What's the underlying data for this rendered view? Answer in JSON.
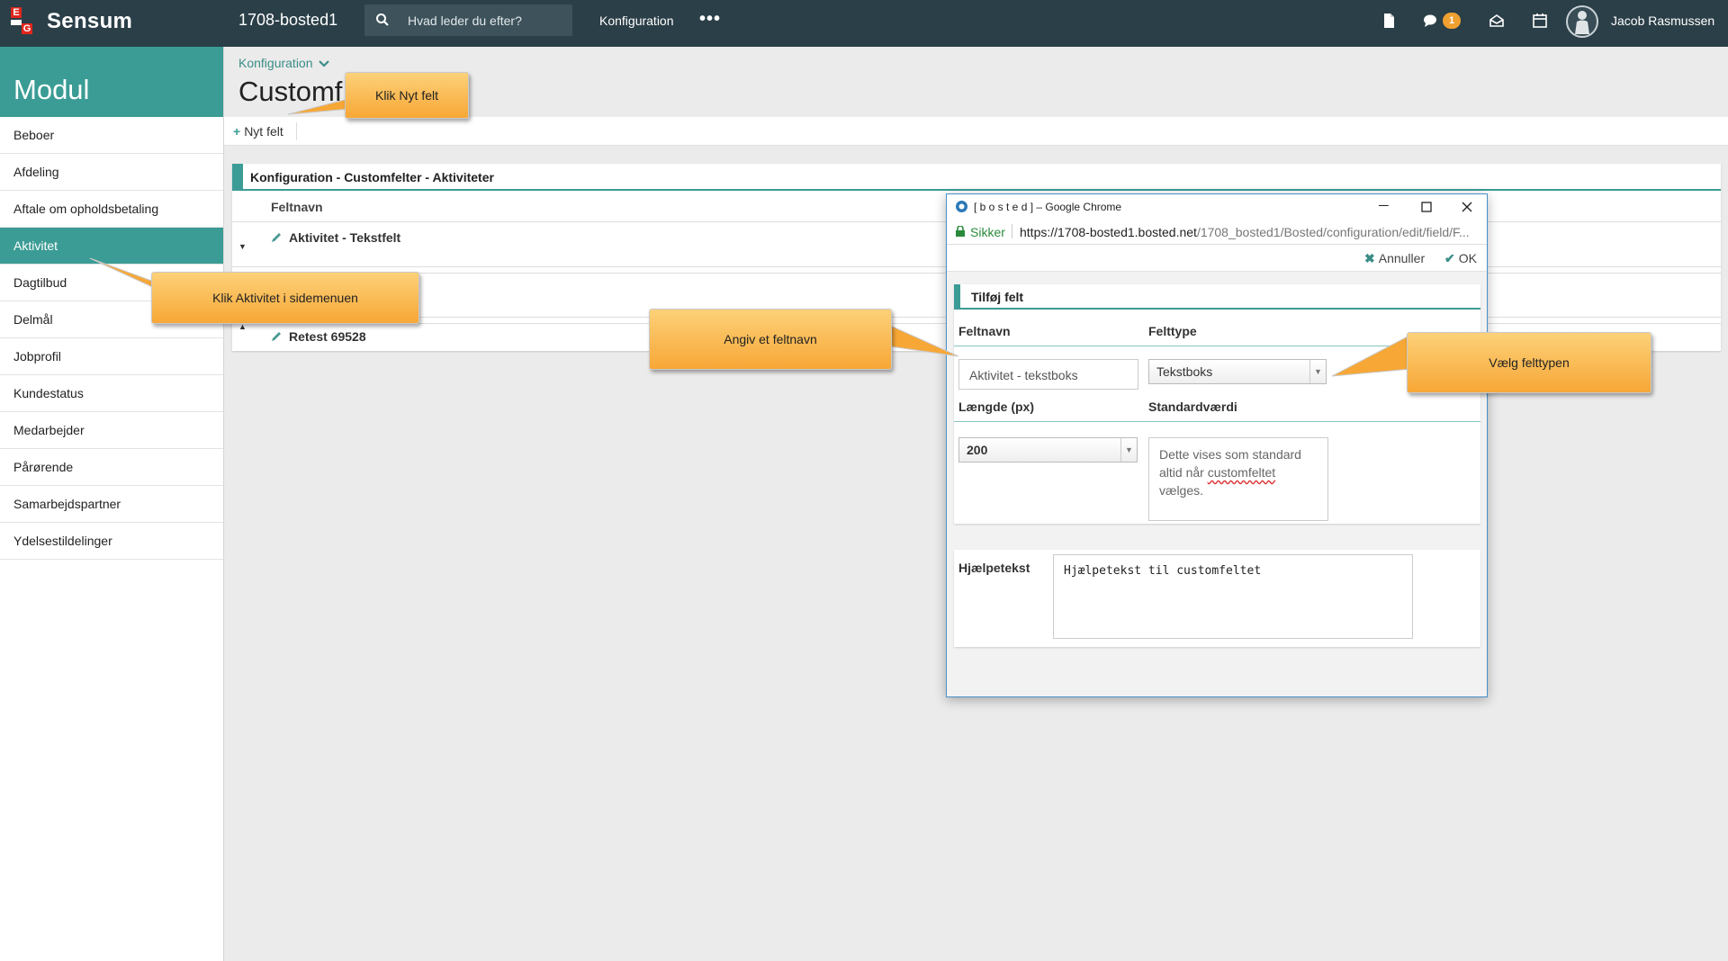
{
  "topbar": {
    "logo_letters": [
      "E",
      "G"
    ],
    "brand": "Sensum",
    "instance": "1708-bosted1",
    "search_placeholder": "Hvad leder du efter?",
    "nav_item": "Konfiguration",
    "more": "•••",
    "notification_count": "1",
    "user_name": "Jacob Rasmussen"
  },
  "sidebar": {
    "title": "Modul",
    "items": [
      {
        "label": "Beboer",
        "active": false
      },
      {
        "label": "Afdeling",
        "active": false
      },
      {
        "label": "Aftale om opholdsbetaling",
        "active": false
      },
      {
        "label": "Aktivitet",
        "active": true
      },
      {
        "label": "Dagtilbud",
        "active": false
      },
      {
        "label": "Delmål",
        "active": false
      },
      {
        "label": "Jobprofil",
        "active": false
      },
      {
        "label": "Kundestatus",
        "active": false
      },
      {
        "label": "Medarbejder",
        "active": false
      },
      {
        "label": "Pårørende",
        "active": false
      },
      {
        "label": "Samarbejdspartner",
        "active": false
      },
      {
        "label": "Ydelsestildelinger",
        "active": false
      }
    ]
  },
  "main": {
    "breadcrumb": "Konfiguration",
    "page_title": "Customf",
    "toolbar_new": "Nyt felt",
    "panel_title": "Konfiguration - Customfelter - Aktiviteter",
    "column_header": "Feltnavn",
    "rows": [
      {
        "label": "Aktivitet - Tekstfelt"
      },
      {
        "label": "Retest 69528"
      }
    ]
  },
  "popup": {
    "window_title": "[ b o s t e d ] – Google Chrome",
    "secure_label": "Sikker",
    "url_host": "https://1708-bosted1.bosted.net",
    "url_path": "/1708_bosted1/Bosted/configuration/edit/field/F...",
    "cancel": "Annuller",
    "ok": "OK",
    "section_title": "Tilføj felt",
    "field_name_label": "Feltnavn",
    "field_type_label": "Felttype",
    "field_name_value": "Aktivitet - tekstboks",
    "field_type_value": "Tekstboks",
    "length_label": "Længde (px)",
    "default_label": "Standardværdi",
    "length_value": "200",
    "default_text_a": "Dette vises som standard altid når ",
    "default_text_b": "customfeltet",
    "default_text_c": " vælges.",
    "help_label": "Hjælpetekst",
    "help_value": "Hjælpetekst til customfeltet"
  },
  "callouts": {
    "new_field": "Klik Nyt felt",
    "activity": "Klik Aktivitet i sidemenuen",
    "field_name": "Angiv et feltnavn",
    "field_type": "Vælg felttypen"
  },
  "colors": {
    "topbar": "#2b3f48",
    "accent": "#3b9c95",
    "logo_red": "#e1261c",
    "callout": "#f7a736",
    "badge": "#f0a030"
  }
}
